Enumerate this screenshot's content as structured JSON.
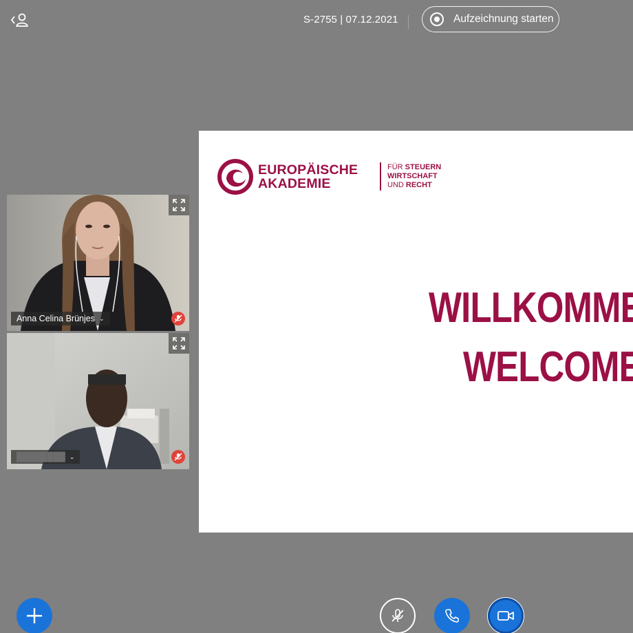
{
  "header": {
    "meeting_info": "S-2755 | 07.12.2021",
    "record_label": "Aufzeichnung starten"
  },
  "participants": [
    {
      "name": "Anna Celina Brünjes",
      "muted": true
    },
    {
      "name": "████████",
      "muted": true
    }
  ],
  "presentation": {
    "logo_line1": "EUROPÄISCHE",
    "logo_line2": "AKADEMIE",
    "logo_sub1_light": "FÜR ",
    "logo_sub1_bold": "STEUERN",
    "logo_sub2": "WIRTSCHAFT",
    "logo_sub3_light": "UND ",
    "logo_sub3_bold": "RECHT",
    "line1": "WILLKOMMEN",
    "line2": "WELCOME"
  },
  "colors": {
    "background": "#808080",
    "brand": "#9b1045",
    "primary_button": "#1a73d9",
    "muted_indicator": "#e0433a"
  },
  "icons": {
    "user_toggle": "user-icon",
    "record": "record-icon",
    "expand": "expand-icon",
    "mute": "mic-off-icon",
    "add": "plus-icon",
    "mic": "mic-off-icon",
    "phone": "phone-icon",
    "camera": "camera-icon"
  }
}
